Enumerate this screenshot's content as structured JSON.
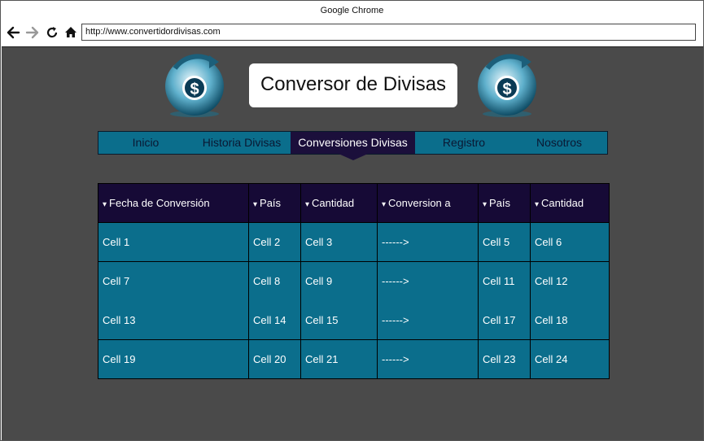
{
  "window": {
    "title": "Google Chrome"
  },
  "toolbar": {
    "url": "http://www.convertidordivisas.com",
    "back_icon": "back-arrow-icon",
    "forward_icon": "forward-arrow-icon",
    "reload_icon": "reload-icon",
    "home_icon": "home-icon"
  },
  "header": {
    "title": "Conversor de Divisas",
    "logo_icon": "globe-dollar-icon"
  },
  "menu": {
    "items": [
      {
        "label": "Inicio"
      },
      {
        "label": "Historia Divisas"
      },
      {
        "label": "Conversiones Divisas",
        "active": true
      },
      {
        "label": "Registro"
      },
      {
        "label": "Nosotros"
      }
    ]
  },
  "table": {
    "sort_glyph": "▾",
    "headers": [
      "Fecha de Conversión",
      "País",
      "Cantidad",
      "Conversion a",
      "País",
      "Cantidad"
    ],
    "rows": [
      [
        "Cell 1",
        "Cell 2",
        "Cell 3",
        "------>",
        "Cell 5",
        "Cell 6"
      ],
      [
        "Cell 7",
        "Cell 8",
        "Cell 9",
        "------>",
        "Cell 11",
        "Cell 12"
      ],
      [
        "Cell 13",
        "Cell 14",
        "Cell 15",
        "------>",
        "Cell 17",
        "Cell 18"
      ],
      [
        "Cell 19",
        "Cell 20",
        "Cell 21",
        "------>",
        "Cell 23",
        "Cell 24"
      ]
    ]
  },
  "colors": {
    "viewport_bg": "#4a4a4a",
    "menu_bg": "#0b6e8c",
    "menu_active": "#1b0f3b",
    "table_header": "#160a36",
    "table_cell": "#0b6e8c"
  }
}
